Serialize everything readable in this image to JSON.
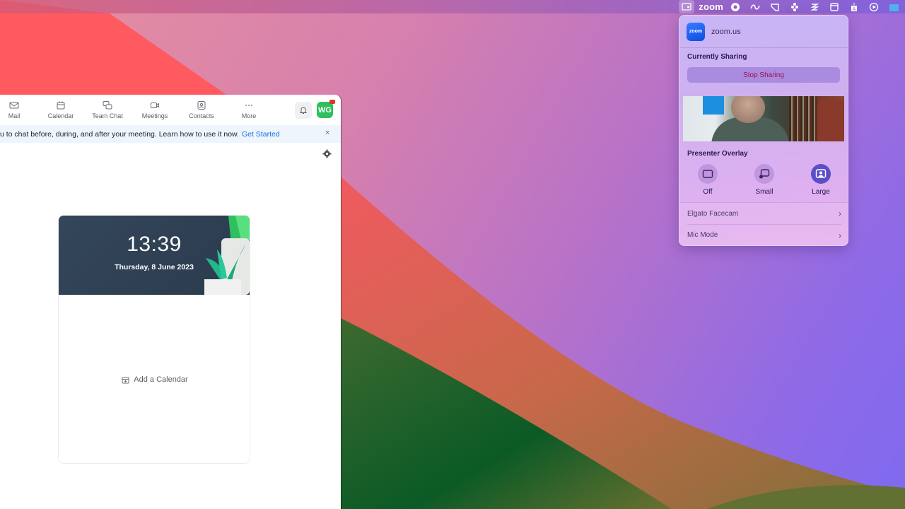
{
  "menubar": {
    "items": [
      {
        "icon": "screen-share-icon",
        "active": true
      },
      {
        "label": "zoom"
      },
      {
        "icon": "record-icon"
      },
      {
        "icon": "infinity-icon"
      },
      {
        "icon": "cursor-icon"
      },
      {
        "icon": "flower-icon"
      },
      {
        "icon": "wave-icon"
      },
      {
        "icon": "window-icon"
      },
      {
        "icon": "translate-icon"
      },
      {
        "icon": "play-icon"
      },
      {
        "icon": "folder-icon"
      }
    ]
  },
  "popover": {
    "app_icon_text": "zoom",
    "app_name": "zoom.us",
    "currently_sharing_label": "Currently Sharing",
    "stop_sharing_label": "Stop Sharing",
    "presenter_overlay_label": "Presenter Overlay",
    "overlay_options": [
      {
        "label": "Off",
        "selected": false
      },
      {
        "label": "Small",
        "selected": false
      },
      {
        "label": "Large",
        "selected": true
      }
    ],
    "rows": [
      {
        "label": "Elgato Facecam"
      },
      {
        "label": "Mic Mode"
      }
    ],
    "accent_color": "#5b4fc8",
    "stop_color": "#a0104a"
  },
  "zoom_window": {
    "nav": [
      {
        "label": "Mail",
        "icon": "mail-icon"
      },
      {
        "label": "Calendar",
        "icon": "calendar-icon"
      },
      {
        "label": "Team Chat",
        "icon": "chat-icon"
      },
      {
        "label": "Meetings",
        "icon": "video-icon"
      },
      {
        "label": "Contacts",
        "icon": "contacts-icon"
      },
      {
        "label": "More",
        "icon": "more-icon"
      }
    ],
    "avatar_initials": "WG",
    "banner": {
      "text": "u to chat before, during, and after your meeting. Learn how to use it now.",
      "link": "Get Started",
      "close": "×"
    },
    "calendar_card": {
      "time": "13:39",
      "date": "Thursday, 8 June 2023",
      "add_calendar_label": "Add a Calendar"
    }
  }
}
